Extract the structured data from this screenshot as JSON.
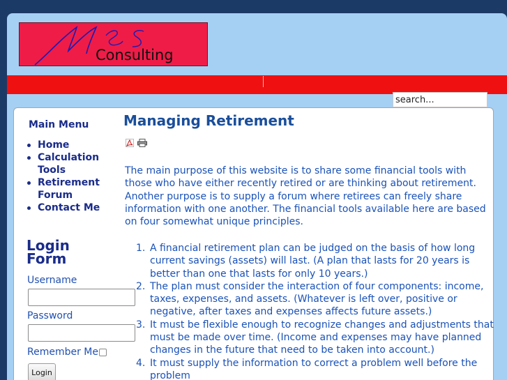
{
  "logo": {
    "script_text": "M E S",
    "consulting_text": "Consulting"
  },
  "search": {
    "value": "search..."
  },
  "sidebar": {
    "menu_title": "Main Menu",
    "items": [
      {
        "label": "Home"
      },
      {
        "label": "Calculation Tools"
      },
      {
        "label": "Retirement Forum"
      },
      {
        "label": "Contact Me"
      }
    ]
  },
  "login": {
    "title": "Login Form",
    "username_label": "Username",
    "password_label": "Password",
    "remember_label": "Remember Me",
    "button_label": "Login"
  },
  "article": {
    "title": "Managing Retirement",
    "pdf_icon": "pdf-icon",
    "print_icon": "print-icon",
    "intro": "The main purpose of this website is to share some financial tools with those who have either recently retired or are thinking about retirement. Another purpose is to supply a forum where retirees can freely share information with one another. The financial tools available here are based on four somewhat unique principles.",
    "principles": [
      {
        "num": "1.",
        "text": "A financial retirement plan can be judged on the basis of how long current savings (assets) will last. (A plan that lasts for 20 years is better than one that lasts for only 10 years.)"
      },
      {
        "num": "2.",
        "text": "The plan must consider the interaction of four components: income, taxes, expenses, and assets. (Whatever is left over, positive or negative, after taxes and expenses affects future assets.)"
      },
      {
        "num": "3.",
        "text": "It must be flexible enough to recognize changes and adjustments that must be made over time. (Income and expenses may have planned changes in the future that need to be taken into account.)"
      },
      {
        "num": "4.",
        "text": "It must supply the information to correct a problem well before the problem"
      }
    ]
  },
  "colors": {
    "background": "#1c3a66",
    "header": "#a6cff4",
    "logo_red": "#ef1c48",
    "nav_red": "#ef1111",
    "link_blue": "#1a2c8a",
    "text_blue": "#1a52b8"
  }
}
